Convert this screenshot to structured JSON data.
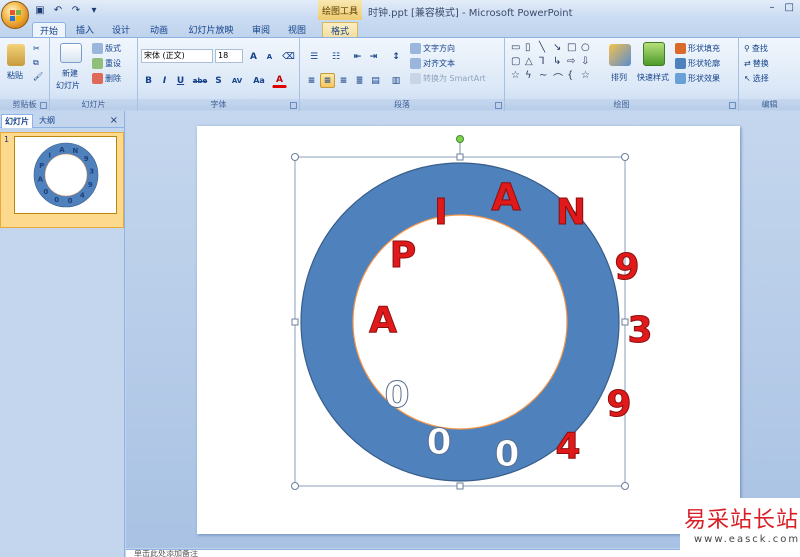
{
  "app": {
    "context_tab_label": "绘图工具",
    "title": "时钟.ppt [兼容模式] - Microsoft PowerPoint"
  },
  "tabs": [
    "开始",
    "插入",
    "设计",
    "动画",
    "幻灯片放映",
    "审阅",
    "视图",
    "格式"
  ],
  "ribbon": {
    "clipboard": {
      "label": "剪贴板",
      "paste": "粘贴"
    },
    "slides": {
      "label": "幻灯片",
      "new_slide": "新建",
      "new_slide2": "幻灯片",
      "layout": "版式",
      "reset": "重设",
      "delete": "删除"
    },
    "font": {
      "label": "字体",
      "font_name": "宋体 (正文)",
      "font_size": "18",
      "grow": "A",
      "shrink": "A",
      "bold": "B",
      "italic": "I",
      "underline": "U",
      "strike": "abe",
      "shadow": "S",
      "spacing": "AV",
      "case": "Aa",
      "color": "A"
    },
    "paragraph": {
      "label": "段落",
      "text_direction": "文字方向",
      "align_text": "对齐文本",
      "smartart": "转换为 SmartArt"
    },
    "drawing": {
      "label": "绘图",
      "arrange": "排列",
      "quick_styles": "快速样式",
      "shape_fill": "形状填充",
      "shape_outline": "形状轮廓",
      "shape_effects": "形状效果"
    },
    "editing": {
      "label": "编辑",
      "find": "查找",
      "replace": "替换",
      "select": "选择"
    }
  },
  "pane": {
    "tab_slides": "幻灯片",
    "tab_outline": "大纲",
    "close": "×",
    "slide_number": "1"
  },
  "slide": {
    "ring_letters": [
      "A",
      "P",
      "I",
      "A",
      "N",
      "9",
      "3",
      "9",
      "4",
      "0",
      "0",
      "0"
    ],
    "colors": {
      "ring_fill": "#4f81bd",
      "ring_stroke": "#385d8a",
      "inner_stroke": "#f79646",
      "red_letter": "#e01a1a",
      "white_letter": "#ffffff",
      "handle": "#7fd24f"
    }
  },
  "notes": {
    "placeholder": "单击此处添加备注"
  },
  "watermark": {
    "cn": "易采站长站",
    "en": "www.easck.com"
  }
}
